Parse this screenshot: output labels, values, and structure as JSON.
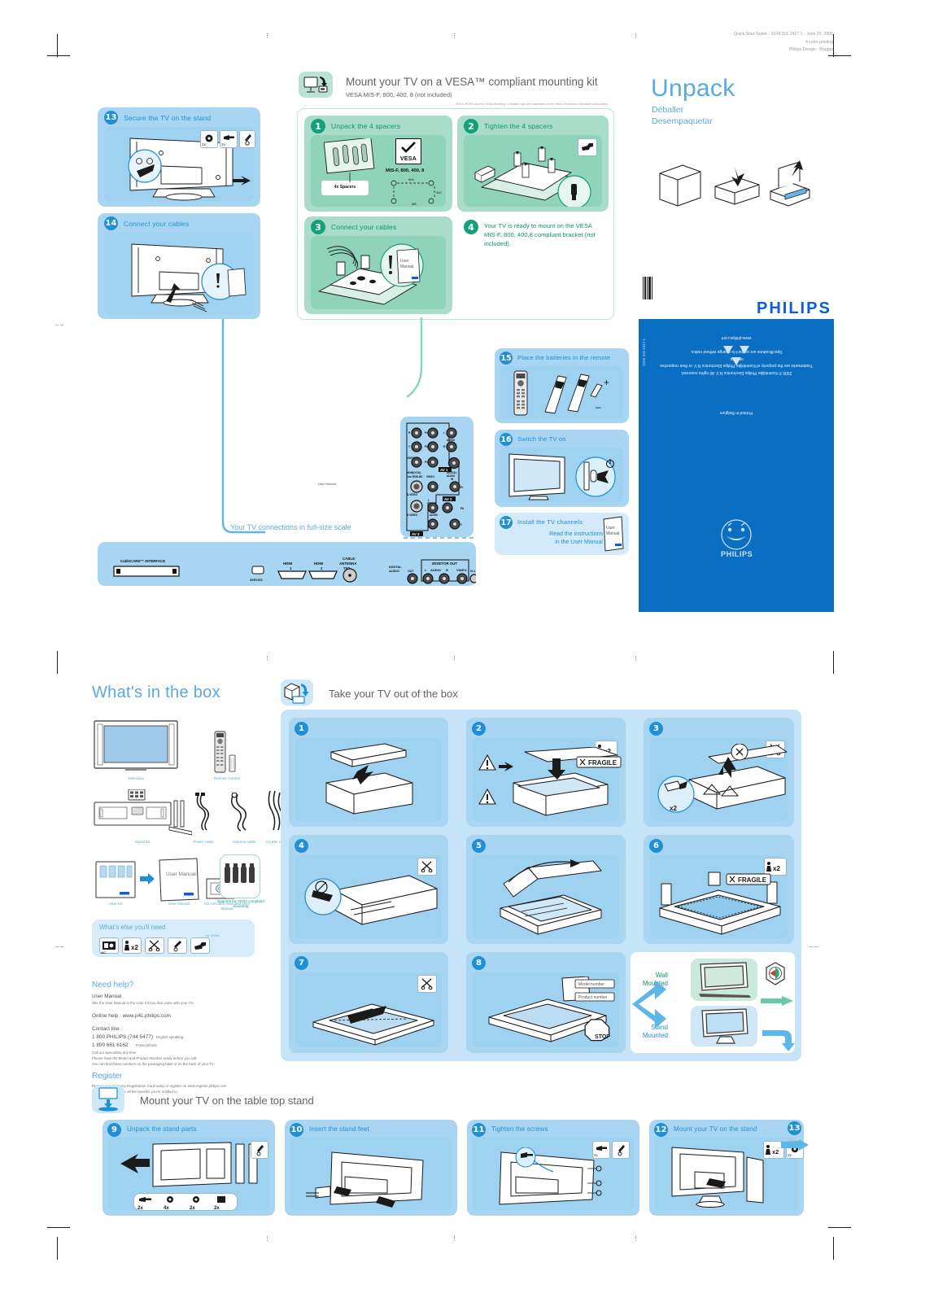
{
  "print_info": {
    "line1": "Quick Start Guide - 3104 315 2417.1 - June 29, 2006",
    "line2": "4 color printing",
    "line3": "Philips Design - Brugge"
  },
  "unpack": {
    "title": "Unpack",
    "sub_fr": "Déballer",
    "sub_es": "Desempaquetar"
  },
  "vesa": {
    "title": "Mount your TV on a VESA™ compliant mounting kit",
    "subtitle": "VESA MIS-F, 800, 400, 8 (not included)",
    "trademark_note": "VESA, ROHS and the VESA Mounting Compliant logo are trademarks of the Video Electronics Standards Association.",
    "steps": [
      {
        "num": "1",
        "title": "Unpack the 4 spacers",
        "spacers_label": "4x Spacers",
        "vesa_badge": "VESA",
        "spec": "MIS-F, 800, 400, 8",
        "dim_w": "800",
        "dim_h": "400",
        "dim_m": "M8"
      },
      {
        "num": "2",
        "title": "Tighten the 4 spacers"
      },
      {
        "num": "3",
        "title": "Connect your cables",
        "manual": "User Manual"
      },
      {
        "num": "4",
        "title": "",
        "body": "Your TV is ready to mount on the VESA MIS-F, 800, 400,8 compliant bracket (not included)."
      }
    ]
  },
  "left_steps": [
    {
      "num": "13",
      "title": "Secure the TV on the stand",
      "tools": [
        "2x",
        "2x"
      ]
    },
    {
      "num": "14",
      "title": "Connect your cables",
      "manual": "User Manual"
    }
  ],
  "right_steps": [
    {
      "num": "15",
      "title": "Place the batteries in the remote",
      "plus": "+",
      "minus": "–"
    },
    {
      "num": "16",
      "title": "Switch the TV on"
    },
    {
      "num": "17",
      "title": "Install the TV channels",
      "body1": "Read the instructions",
      "body2": "in the User Manual",
      "manual": "User Manual"
    }
  ],
  "connections": {
    "caption": "Your TV connections in full-size scale",
    "side_panel": {
      "av1_tag": "AV 1",
      "av2_tag": "AV 2",
      "av3_tag": "AV 3",
      "labels": [
        "R",
        "Pr / R",
        "L",
        "AUDIO",
        "Y",
        "Pb / B",
        "R",
        "VIDEO",
        "Pr / G",
        "HDMI(VGA)",
        "into RGB-HD",
        "DIGITAL AUDIO IN",
        "S-VIDEO",
        "VIDEO",
        "Pr",
        "Pb",
        "Y",
        "L",
        "AUDIO",
        "R"
      ]
    },
    "bottom_panel": {
      "cablecard": "CableCARD™ INTERFACE",
      "service": "SERVICE",
      "hdmi1_a": "HDMI",
      "hdmi1_b": "1",
      "hdmi2_a": "HDMI",
      "hdmi2_b": "2",
      "antenna_a": "CABLE",
      "antenna_b": "ANTENNA",
      "antenna_c": "75Ω",
      "digital_audio_a": "DIGITAL",
      "digital_audio_b": "AUDIO",
      "digital_audio_out": "OUT",
      "monitor_out": "MONITOR OUT",
      "mon_l": "L",
      "mon_audio": "AUDIO",
      "mon_r": "R",
      "mon_video": "VIDEO",
      "glink": "G-LINK"
    }
  },
  "philips_panel": {
    "logo": "PHILIPS",
    "shield_text": "PHILIPS",
    "back_line1": "Specifications are subject to change without notice.",
    "back_line2": "Trademarks are the property of Koninklijke Philips Electronics N.V. or their respective owners.",
    "back_line3": "2006 © Koninklijke Philips Electronics N.V. All rights reserved.",
    "back_line4": "www.philips.com",
    "back_line5": "Printed in Belgium",
    "side_code": "3104 315 2417.1"
  },
  "box": {
    "title": "What's in the box",
    "items": [
      {
        "label": "Television"
      },
      {
        "label": "Remote Control"
      },
      {
        "label": "Stand Kit"
      },
      {
        "label": "Power cable"
      },
      {
        "label": "Antenna cable"
      },
      {
        "label": "G-LINK cable"
      },
      {
        "label": "User Kit"
      },
      {
        "label": "User Manual"
      },
      {
        "label": "CD-rom with extended User Manual"
      },
      {
        "label": "Spacers for VESA compliant mounting"
      }
    ],
    "else_title": "What's else you'll need",
    "else_for_vesa": "for VESA",
    "else_ac": "AC",
    "else_x2": "x2"
  },
  "help": {
    "title": "Need help?",
    "manual_h": "User Manual",
    "manual_t": "See the User Manual in the User Kit box that came with your TV.",
    "online": "Online help : www.p4c.philips.com",
    "contact_h": "Contact line :",
    "phone1": "1 800 PHILIPS (744 5477)",
    "phone1_n": "English speaking",
    "phone2": "1 800 661 6162",
    "phone2_n": "Francophone",
    "note1": "Call our specialists any time.",
    "note2": "Please have the Model and Product Number ready before you call.",
    "note3": "You can find these numbers on the packaging label or on the back of your TV.",
    "register_h": "Register",
    "register_t1": "Return your Warranty Registration Card today or register on www.register.philips.com",
    "register_t2": "to ensure you receive all the benefits you're entitled to."
  },
  "takeout": {
    "title": "Take your TV out of the box",
    "steps": [
      {
        "num": "1"
      },
      {
        "num": "2",
        "fragile": "FRAGILE",
        "x2": "x2"
      },
      {
        "num": "3",
        "x2": "x2"
      },
      {
        "num": "4"
      },
      {
        "num": "5"
      },
      {
        "num": "6",
        "fragile": "FRAGILE",
        "x2": "x2"
      },
      {
        "num": "7"
      },
      {
        "num": "8",
        "model": "Model number",
        "product": "Product number",
        "stop": "STOP"
      }
    ],
    "wall_l1": "Wall",
    "wall_l2": "Mounted",
    "stand_l1": "Stand",
    "stand_l2": "Mounted"
  },
  "tabletop": {
    "title": "Mount your TV on the table top stand",
    "steps": [
      {
        "num": "9",
        "title": "Unpack the stand parts",
        "tools": [
          "2x",
          "4x",
          "2x",
          "2x"
        ]
      },
      {
        "num": "10",
        "title": "Insert the stand feet"
      },
      {
        "num": "11",
        "title": "Tighten the screws",
        "tools": [
          "4x"
        ]
      },
      {
        "num": "12",
        "title": "Mount your TV on the stand",
        "tools": [
          "x2",
          "2x"
        ]
      },
      {
        "num": "13",
        "title": ""
      }
    ]
  },
  "colors": {
    "blue": "#1f8fd6",
    "light_blue": "#a8d5f2",
    "green": "#0e9374",
    "light_green": "#a9ddc9",
    "philips_blue": "#0b5ed7"
  }
}
